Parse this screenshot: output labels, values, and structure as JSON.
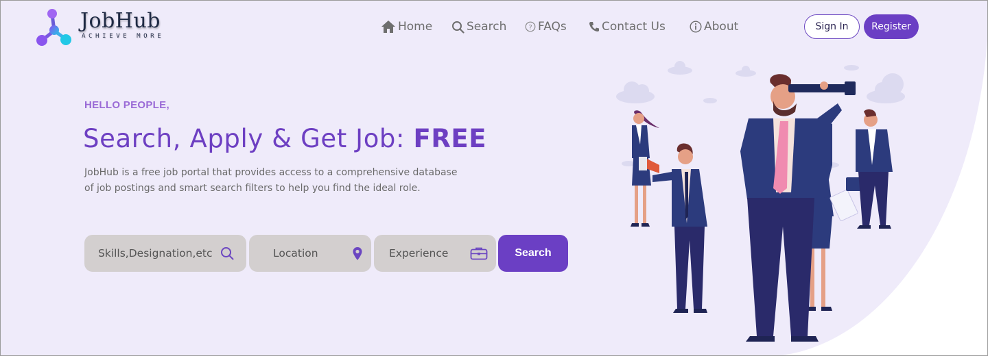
{
  "brand": {
    "name": "JobHub",
    "tagline": "ACHIEVE MORE"
  },
  "nav": {
    "items": [
      {
        "label": "Home",
        "icon": "home-icon"
      },
      {
        "label": "Search",
        "icon": "search-icon"
      },
      {
        "label": "FAQs",
        "icon": "question-circle-icon"
      },
      {
        "label": "Contact Us",
        "icon": "phone-icon"
      },
      {
        "label": "About",
        "icon": "info-circle-icon"
      }
    ],
    "signin_label": "Sign In",
    "register_label": "Register"
  },
  "hero": {
    "eyebrow": "HELLO PEOPLE,",
    "headline": "Search, Apply & Get Job: ",
    "headline_emphasis": "FREE",
    "description_line1": "JobHub is a free job portal that provides access to a comprehensive database",
    "description_line2": "of job postings and smart search filters to help you find the ideal role."
  },
  "search": {
    "skills_placeholder": "Skills,Designation,etc",
    "location_placeholder": "Location",
    "experience_placeholder": "Experience",
    "button_label": "Search",
    "icons": [
      "search-icon",
      "location-pin-icon",
      "briefcase-icon"
    ]
  },
  "colors": {
    "primary": "#6b3fc4",
    "hero_background": "#efebfa",
    "field_background": "#d3cfcf",
    "eyebrow": "#9a6ad6"
  }
}
